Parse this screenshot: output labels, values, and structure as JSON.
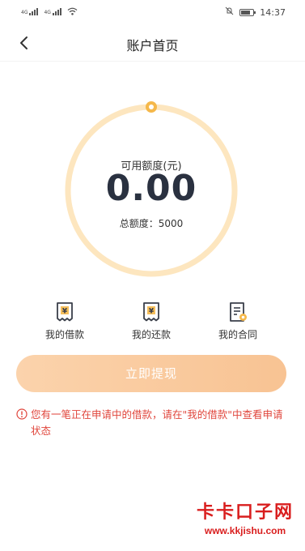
{
  "status_bar": {
    "time": "14:37",
    "signal_tag": "4G",
    "battery_level": 0.75
  },
  "nav": {
    "title": "账户首页"
  },
  "credit": {
    "available_label": "可用额度(元)",
    "available_amount": "0.00",
    "total_label": "总额度：5000",
    "usage_fraction": 0
  },
  "actions": [
    {
      "label": "我的借款",
      "icon": "receipt-yuan-icon"
    },
    {
      "label": "我的还款",
      "icon": "receipt-yuan-icon"
    },
    {
      "label": "我的合同",
      "icon": "contract-icon"
    }
  ],
  "withdraw_button": {
    "label": "立即提现"
  },
  "notice": {
    "text": "您有一笔正在申请中的借款，请在\"我的借款\"中查看申请状态",
    "icon": "warning-circle-icon"
  },
  "watermark": {
    "title": "卡卡口子网",
    "url": "www.kkjishu.com"
  },
  "colors": {
    "accent": "#f5b84a",
    "ring": "#fde6bf",
    "button": "#f9c99c",
    "alert": "#e0463c",
    "watermark": "#d91e1e"
  }
}
